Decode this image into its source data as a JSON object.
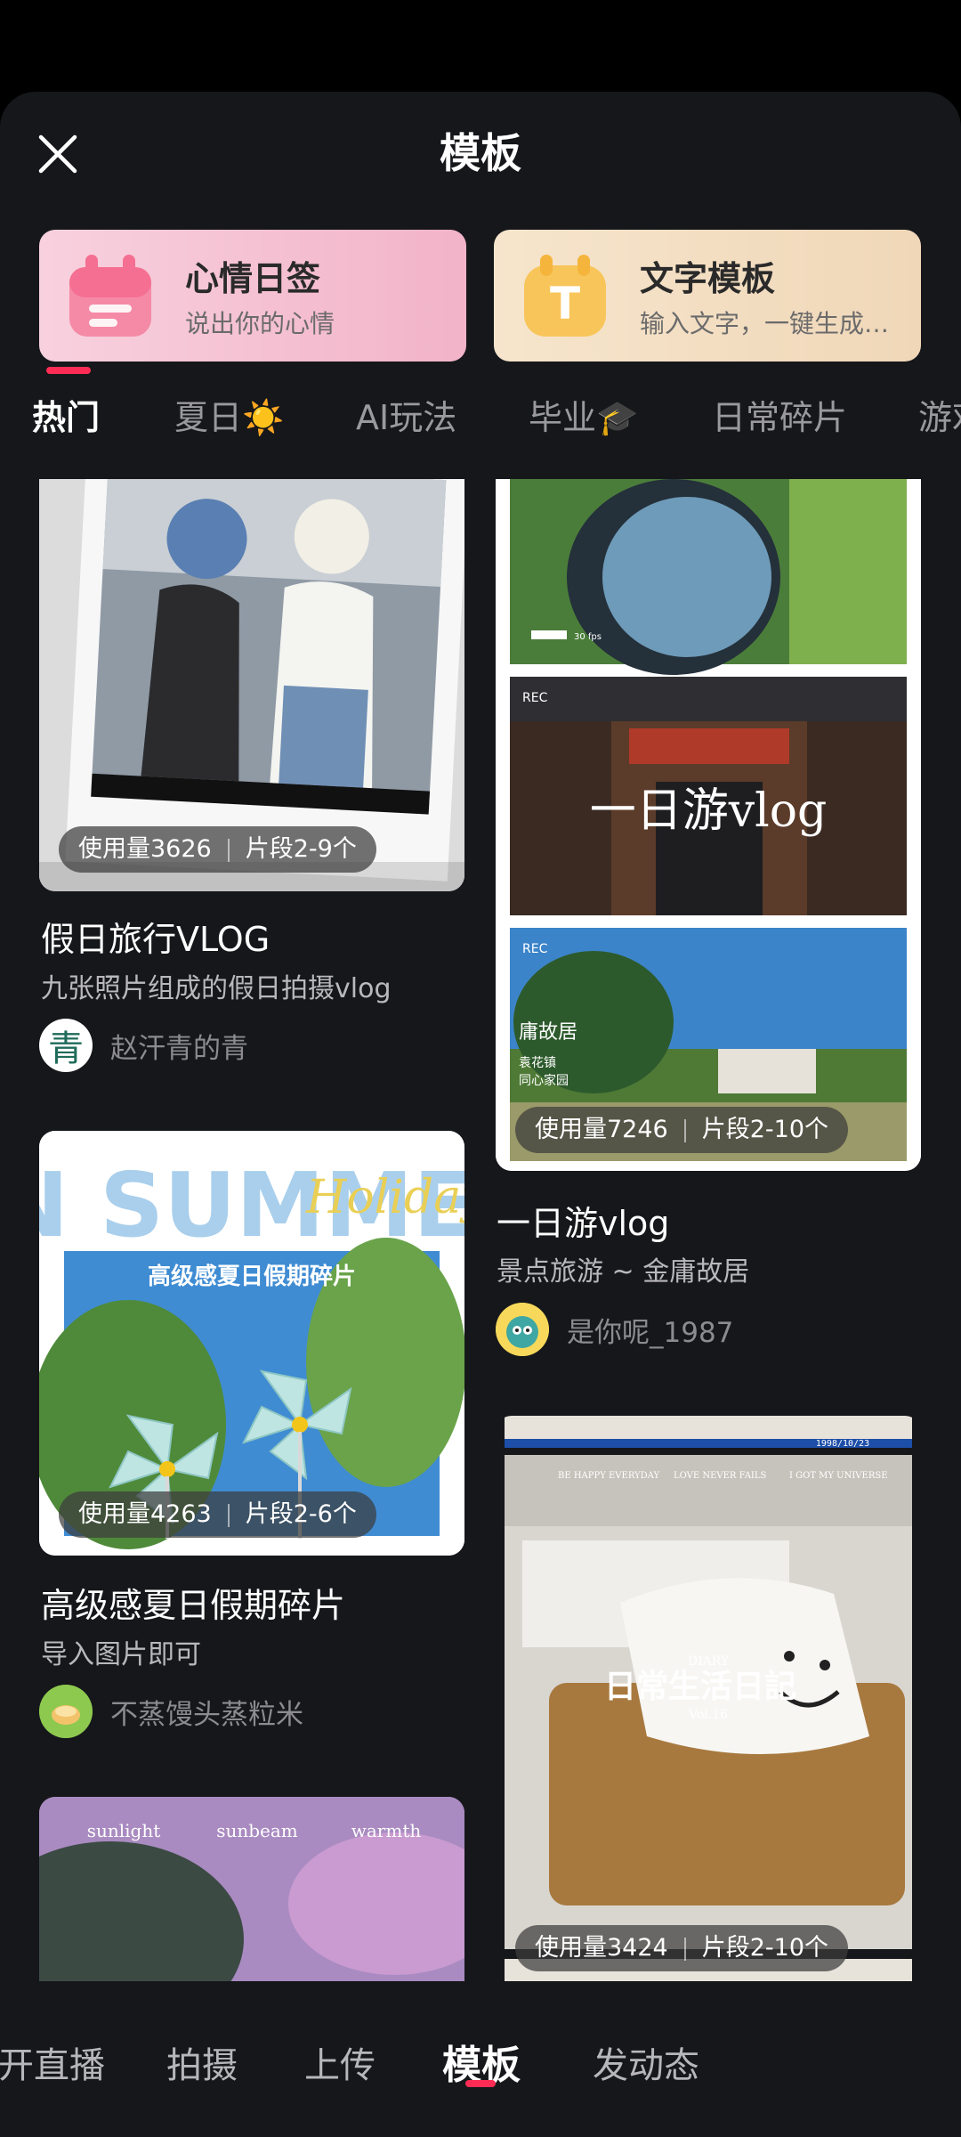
{
  "header": {
    "title": "模板"
  },
  "features": [
    {
      "title": "心情日签",
      "subtitle": "说出你的心情",
      "icon": "calendar-icon"
    },
    {
      "title": "文字模板",
      "subtitle": "输入文字，一键生成…",
      "icon": "text-t-icon",
      "icon_letter": "T"
    }
  ],
  "tabs": [
    "热门",
    "夏日☀️",
    "AI玩法",
    "毕业🎓",
    "日常碎片",
    "游戏"
  ],
  "cards": [
    {
      "usage": "使用量3626",
      "segments": "片段2-9个",
      "title": "假日旅行VLOG",
      "subtitle": "九张照片组成的假日拍摄vlog",
      "author": "赵汗青的青",
      "avatar_char": "青"
    },
    {
      "usage": "使用量7246",
      "segments": "片段2-10个",
      "title": "一日游vlog",
      "subtitle": "景点旅游 ~ 金庸故居",
      "author": "是你呢_1987",
      "overlay_text": "一日游vlog",
      "frame_labels": [
        "REC",
        "30 fps",
        "庸故居",
        "袁花镇",
        "同心家园"
      ]
    },
    {
      "usage": "使用量4263",
      "segments": "片段2-6个",
      "title": "高级感夏日假期碎片",
      "subtitle": "导入图片即可",
      "author": "不蒸馒头蒸粒米",
      "poster_big": "IN SUMMER",
      "poster_script": "Holiday",
      "poster_caption": "高级感夏日假期碎片"
    },
    {
      "usage": "使用量3424",
      "segments": "片段2-10个",
      "diary_header": [
        "BE HAPPY EVERYDAY",
        "LOVE NEVER FAILS",
        "I GOT MY UNIVERSE"
      ],
      "diary_top": "DIARY",
      "diary_title": "日常生活日記",
      "diary_vol": "Vol.16",
      "date": "1998/10/23"
    },
    {
      "words": [
        "sunlight",
        "sunbeam",
        "warmth"
      ]
    }
  ],
  "bottom_nav": [
    "开直播",
    "拍摄",
    "上传",
    "模板",
    "发动态"
  ],
  "colors": {
    "accent": "#fe2c55",
    "background": "#16171b"
  }
}
